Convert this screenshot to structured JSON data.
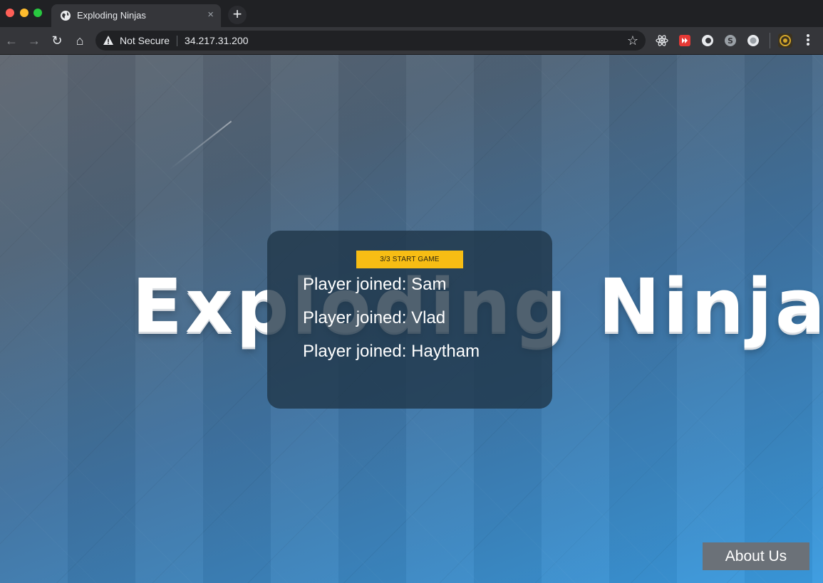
{
  "browser": {
    "tab_title": "Exploding Ninjas",
    "new_tab_symbol": "+",
    "close_symbol": "×",
    "security_label": "Not Secure",
    "url": "34.217.31.200",
    "nav": {
      "back": "←",
      "forward": "→",
      "reload": "↻",
      "home": "⌂",
      "bookmark": "☆"
    },
    "extensions": [
      "react-devtools-icon",
      "red-extension-icon",
      "grammar-extension-icon",
      "skype-extension-icon",
      "record-extension-icon",
      "profile-avatar-icon"
    ]
  },
  "page": {
    "logo_text": "Exploding Ninja",
    "lobby": {
      "start_button": "3/3 START GAME",
      "players": [
        "Player joined: Sam",
        "Player joined: Vlad",
        "Player joined: Haytham"
      ]
    },
    "about_button": "About Us"
  },
  "colors": {
    "start_button": "#f7bd14",
    "about_button": "#6b7178",
    "lobby_panel": "#1f3446"
  }
}
